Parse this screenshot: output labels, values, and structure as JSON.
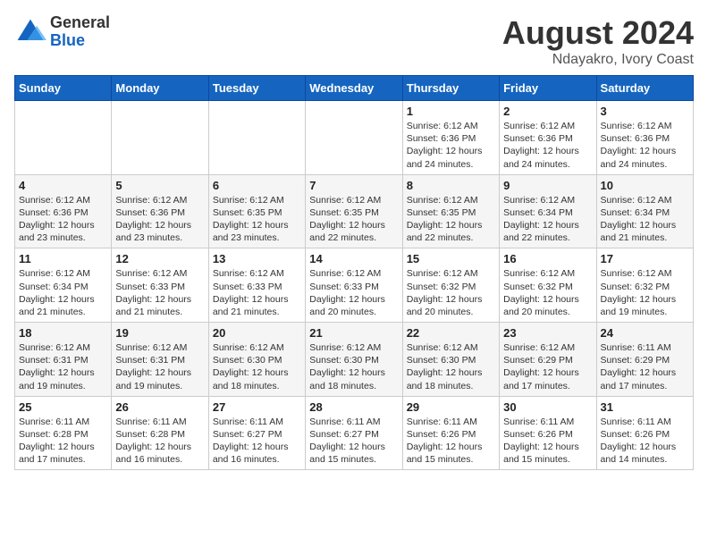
{
  "header": {
    "logo_line1": "General",
    "logo_line2": "Blue",
    "main_title": "August 2024",
    "subtitle": "Ndayakro, Ivory Coast"
  },
  "calendar": {
    "days_of_week": [
      "Sunday",
      "Monday",
      "Tuesday",
      "Wednesday",
      "Thursday",
      "Friday",
      "Saturday"
    ],
    "weeks": [
      [
        {
          "day": "",
          "detail": ""
        },
        {
          "day": "",
          "detail": ""
        },
        {
          "day": "",
          "detail": ""
        },
        {
          "day": "",
          "detail": ""
        },
        {
          "day": "1",
          "detail": "Sunrise: 6:12 AM\nSunset: 6:36 PM\nDaylight: 12 hours\nand 24 minutes."
        },
        {
          "day": "2",
          "detail": "Sunrise: 6:12 AM\nSunset: 6:36 PM\nDaylight: 12 hours\nand 24 minutes."
        },
        {
          "day": "3",
          "detail": "Sunrise: 6:12 AM\nSunset: 6:36 PM\nDaylight: 12 hours\nand 24 minutes."
        }
      ],
      [
        {
          "day": "4",
          "detail": "Sunrise: 6:12 AM\nSunset: 6:36 PM\nDaylight: 12 hours\nand 23 minutes."
        },
        {
          "day": "5",
          "detail": "Sunrise: 6:12 AM\nSunset: 6:36 PM\nDaylight: 12 hours\nand 23 minutes."
        },
        {
          "day": "6",
          "detail": "Sunrise: 6:12 AM\nSunset: 6:35 PM\nDaylight: 12 hours\nand 23 minutes."
        },
        {
          "day": "7",
          "detail": "Sunrise: 6:12 AM\nSunset: 6:35 PM\nDaylight: 12 hours\nand 22 minutes."
        },
        {
          "day": "8",
          "detail": "Sunrise: 6:12 AM\nSunset: 6:35 PM\nDaylight: 12 hours\nand 22 minutes."
        },
        {
          "day": "9",
          "detail": "Sunrise: 6:12 AM\nSunset: 6:34 PM\nDaylight: 12 hours\nand 22 minutes."
        },
        {
          "day": "10",
          "detail": "Sunrise: 6:12 AM\nSunset: 6:34 PM\nDaylight: 12 hours\nand 21 minutes."
        }
      ],
      [
        {
          "day": "11",
          "detail": "Sunrise: 6:12 AM\nSunset: 6:34 PM\nDaylight: 12 hours\nand 21 minutes."
        },
        {
          "day": "12",
          "detail": "Sunrise: 6:12 AM\nSunset: 6:33 PM\nDaylight: 12 hours\nand 21 minutes."
        },
        {
          "day": "13",
          "detail": "Sunrise: 6:12 AM\nSunset: 6:33 PM\nDaylight: 12 hours\nand 21 minutes."
        },
        {
          "day": "14",
          "detail": "Sunrise: 6:12 AM\nSunset: 6:33 PM\nDaylight: 12 hours\nand 20 minutes."
        },
        {
          "day": "15",
          "detail": "Sunrise: 6:12 AM\nSunset: 6:32 PM\nDaylight: 12 hours\nand 20 minutes."
        },
        {
          "day": "16",
          "detail": "Sunrise: 6:12 AM\nSunset: 6:32 PM\nDaylight: 12 hours\nand 20 minutes."
        },
        {
          "day": "17",
          "detail": "Sunrise: 6:12 AM\nSunset: 6:32 PM\nDaylight: 12 hours\nand 19 minutes."
        }
      ],
      [
        {
          "day": "18",
          "detail": "Sunrise: 6:12 AM\nSunset: 6:31 PM\nDaylight: 12 hours\nand 19 minutes."
        },
        {
          "day": "19",
          "detail": "Sunrise: 6:12 AM\nSunset: 6:31 PM\nDaylight: 12 hours\nand 19 minutes."
        },
        {
          "day": "20",
          "detail": "Sunrise: 6:12 AM\nSunset: 6:30 PM\nDaylight: 12 hours\nand 18 minutes."
        },
        {
          "day": "21",
          "detail": "Sunrise: 6:12 AM\nSunset: 6:30 PM\nDaylight: 12 hours\nand 18 minutes."
        },
        {
          "day": "22",
          "detail": "Sunrise: 6:12 AM\nSunset: 6:30 PM\nDaylight: 12 hours\nand 18 minutes."
        },
        {
          "day": "23",
          "detail": "Sunrise: 6:12 AM\nSunset: 6:29 PM\nDaylight: 12 hours\nand 17 minutes."
        },
        {
          "day": "24",
          "detail": "Sunrise: 6:11 AM\nSunset: 6:29 PM\nDaylight: 12 hours\nand 17 minutes."
        }
      ],
      [
        {
          "day": "25",
          "detail": "Sunrise: 6:11 AM\nSunset: 6:28 PM\nDaylight: 12 hours\nand 17 minutes."
        },
        {
          "day": "26",
          "detail": "Sunrise: 6:11 AM\nSunset: 6:28 PM\nDaylight: 12 hours\nand 16 minutes."
        },
        {
          "day": "27",
          "detail": "Sunrise: 6:11 AM\nSunset: 6:27 PM\nDaylight: 12 hours\nand 16 minutes."
        },
        {
          "day": "28",
          "detail": "Sunrise: 6:11 AM\nSunset: 6:27 PM\nDaylight: 12 hours\nand 15 minutes."
        },
        {
          "day": "29",
          "detail": "Sunrise: 6:11 AM\nSunset: 6:26 PM\nDaylight: 12 hours\nand 15 minutes."
        },
        {
          "day": "30",
          "detail": "Sunrise: 6:11 AM\nSunset: 6:26 PM\nDaylight: 12 hours\nand 15 minutes."
        },
        {
          "day": "31",
          "detail": "Sunrise: 6:11 AM\nSunset: 6:26 PM\nDaylight: 12 hours\nand 14 minutes."
        }
      ]
    ]
  }
}
